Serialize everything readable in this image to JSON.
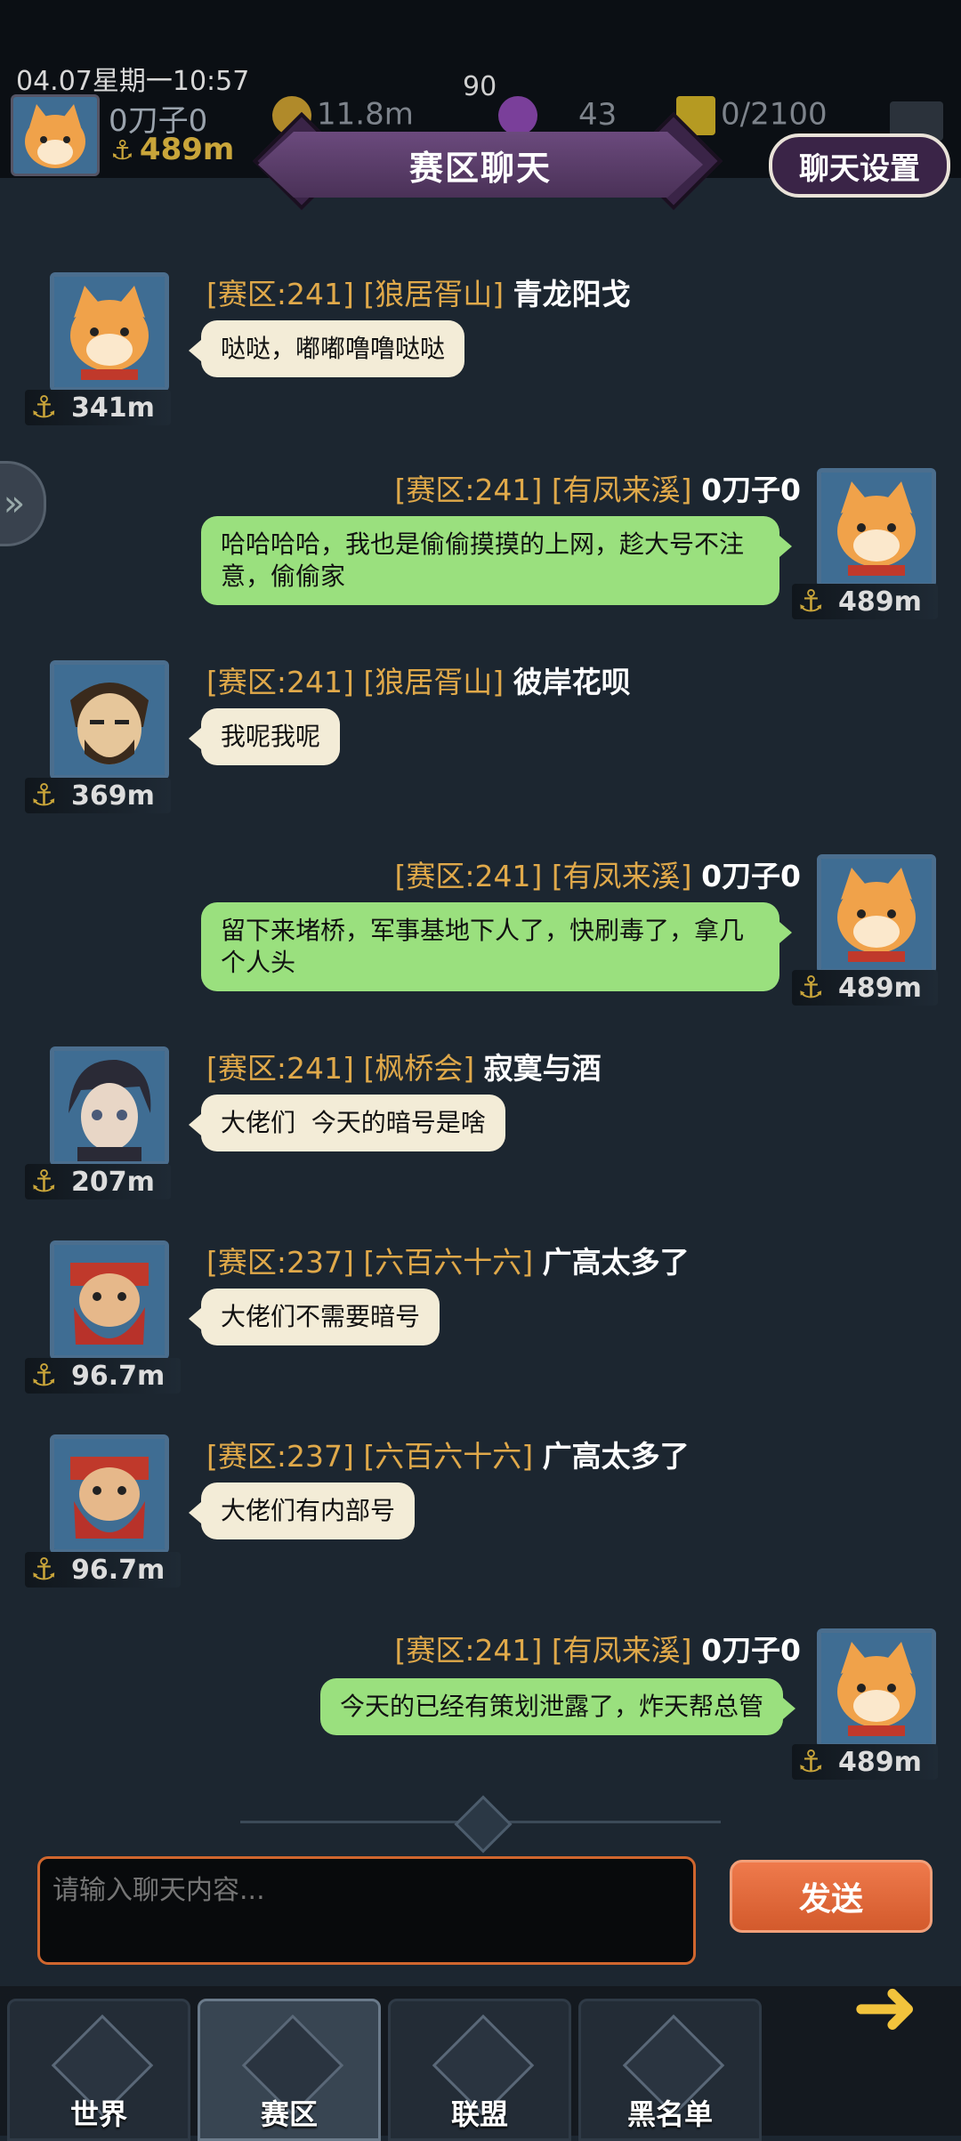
{
  "status": {
    "datetime": "04.07星期一10:57",
    "center_value": "90"
  },
  "player": {
    "name": "0刀子0",
    "distance": "489m"
  },
  "resources": [
    {
      "icon": "gold-coin-icon",
      "value": "11.8m",
      "color": "#b08a2a"
    },
    {
      "icon": "purple-gem-icon",
      "value": "43",
      "color": "#7a3f9a"
    },
    {
      "icon": "energy-icon",
      "value": "0/2100",
      "color": "#b59a22"
    }
  ],
  "header": {
    "title": "赛区聊天",
    "settings_label": "聊天设置"
  },
  "messages": [
    {
      "side": "in",
      "tag": "[赛区:241] [狼居胥山]",
      "name": "青龙阳戈",
      "text": "哒哒，嘟嘟噜噜哒哒",
      "distance": "341m",
      "avatar": "cat-avatar"
    },
    {
      "side": "out",
      "tag": "[赛区:241] [有凤来溪]",
      "name": "0刀子0",
      "text": "哈哈哈哈，我也是偷偷摸摸的上网，趁大号不注意，偷偷家",
      "distance": "489m",
      "avatar": "cat-avatar"
    },
    {
      "side": "in",
      "tag": "[赛区:241] [狼居胥山]",
      "name": "彼岸花呗",
      "text": "我呢我呢",
      "distance": "369m",
      "avatar": "warrior-avatar"
    },
    {
      "side": "out",
      "tag": "[赛区:241] [有凤来溪]",
      "name": "0刀子0",
      "text": "留下来堵桥，军事基地下人了，快刷毒了，拿几个人头",
      "distance": "489m",
      "avatar": "cat-avatar"
    },
    {
      "side": "in",
      "tag": "[赛区:241] [枫桥会]",
      "name": "寂寞与酒",
      "text": "大佬们  今天的暗号是啥",
      "distance": "207m",
      "avatar": "swordsman-avatar"
    },
    {
      "side": "in",
      "tag": "[赛区:237] [六百六十六]",
      "name": "广高太多了",
      "text": "大佬们不需要暗号",
      "distance": "96.7m",
      "avatar": "red-beard-avatar"
    },
    {
      "side": "in",
      "tag": "[赛区:237] [六百六十六]",
      "name": "广高太多了",
      "text": "大佬们有内部号",
      "distance": "96.7m",
      "avatar": "red-beard-avatar"
    },
    {
      "side": "out",
      "tag": "[赛区:241] [有凤来溪]",
      "name": "0刀子0",
      "text": "今天的已经有策划泄露了，炸天帮总管",
      "distance": "489m",
      "avatar": "cat-avatar"
    }
  ],
  "input": {
    "placeholder": "请输入聊天内容...",
    "send_label": "发送"
  },
  "tabs": [
    {
      "label": "世界",
      "icon": "world-emblem-icon"
    },
    {
      "label": "赛区",
      "icon": "region-emblem-icon",
      "active": true
    },
    {
      "label": "联盟",
      "icon": "alliance-emblem-icon"
    },
    {
      "label": "黑名单",
      "icon": "blacklist-emblem-icon"
    }
  ]
}
